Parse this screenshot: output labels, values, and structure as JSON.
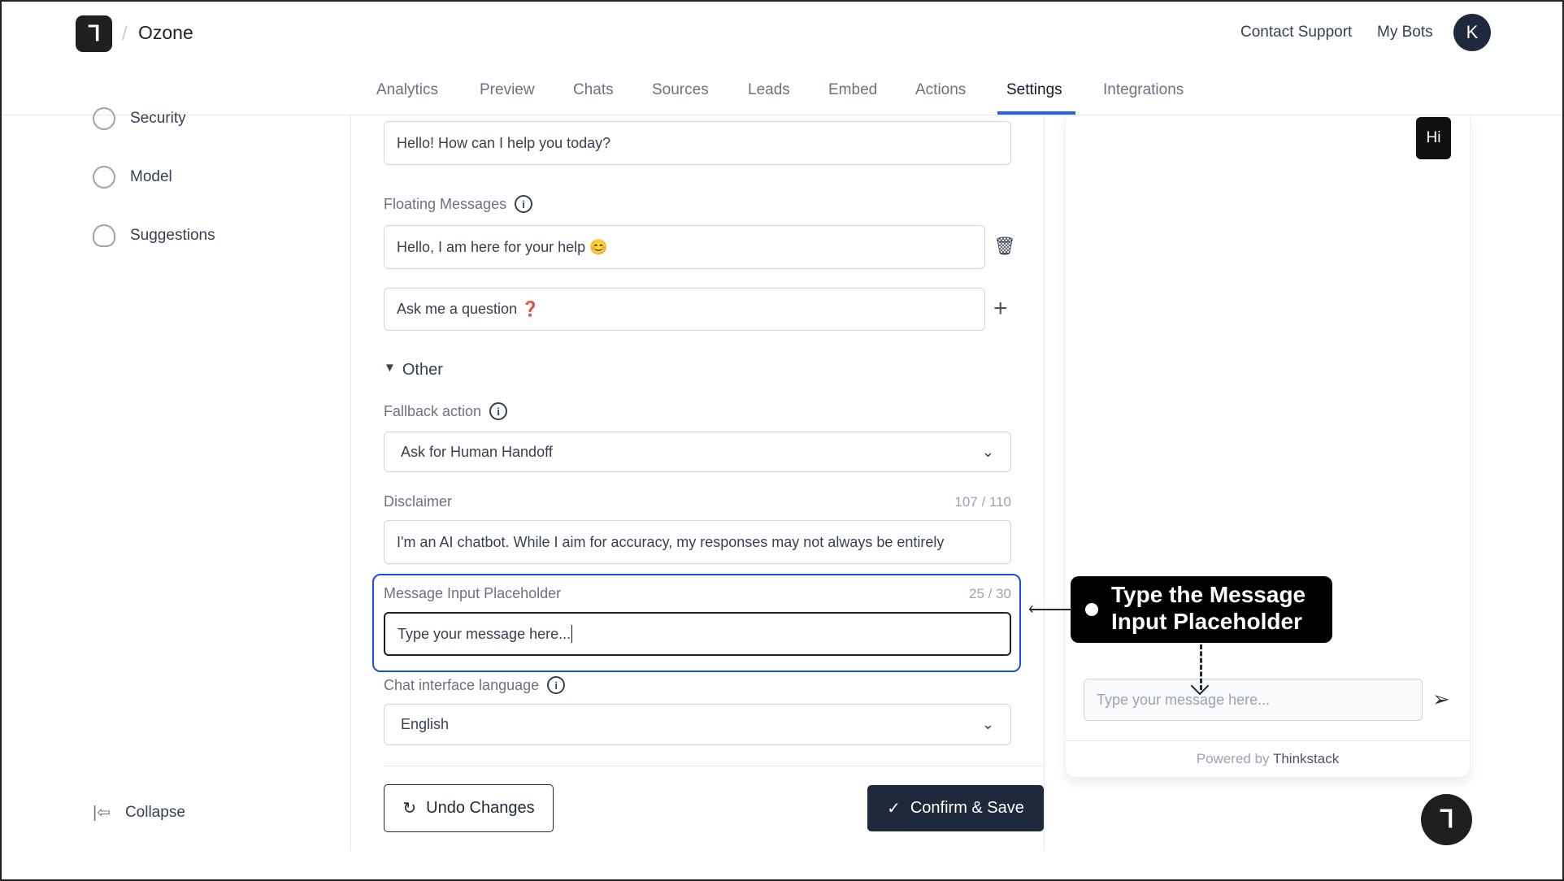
{
  "header": {
    "brand": "Ozone",
    "contact_support": "Contact Support",
    "my_bots": "My Bots",
    "avatar_initial": "K"
  },
  "tabs": [
    "Analytics",
    "Preview",
    "Chats",
    "Sources",
    "Leads",
    "Embed",
    "Actions",
    "Settings",
    "Integrations"
  ],
  "active_tab": "Settings",
  "sidebar": {
    "items": [
      {
        "label": "Security",
        "icon": "shield-check-icon"
      },
      {
        "label": "Model",
        "icon": "brain-icon"
      },
      {
        "label": "Suggestions",
        "icon": "lightbulb-icon"
      }
    ],
    "collapse": "Collapse"
  },
  "form": {
    "welcome_message": "Hello! How can I help you today?",
    "floating_label": "Floating Messages",
    "floating_messages": [
      "Hello, I am here for your help 😊",
      "Ask me a question ❓"
    ],
    "other_section": "Other",
    "fallback_label": "Fallback action",
    "fallback_value": "Ask for Human Handoff",
    "disclaimer_label": "Disclaimer",
    "disclaimer_count": "107 / 110",
    "disclaimer_value": "I'm an AI chatbot. While I aim for accuracy, my responses may not always be entirely",
    "placeholder_label": "Message Input Placeholder",
    "placeholder_count": "25 / 30",
    "placeholder_value": "Type your message here...",
    "language_label": "Chat interface language",
    "language_value": "English",
    "undo": "Undo Changes",
    "confirm": "Confirm & Save"
  },
  "preview": {
    "bubble": "Hi",
    "input_placeholder": "Type your message here...",
    "powered_by": "Powered by",
    "powered_brand": "Thinkstack"
  },
  "callout": {
    "line1": "Type the Message",
    "line2": "Input Placeholder"
  },
  "colors": {
    "accent": "#2563eb",
    "primary_button": "#1e293b"
  }
}
